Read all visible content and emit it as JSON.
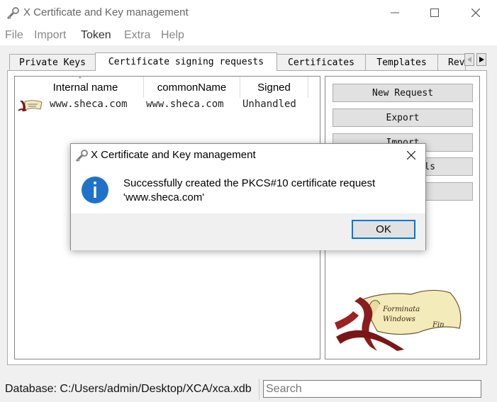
{
  "window": {
    "title": "X Certificate and Key management"
  },
  "menu": [
    "File",
    "Import",
    "Token",
    "Extra",
    "Help"
  ],
  "tabs": [
    "Private Keys",
    "Certificate signing requests",
    "Certificates",
    "Templates",
    "Rev"
  ],
  "list": {
    "columns": [
      "Internal name",
      "commonName",
      "Signed"
    ],
    "rows": [
      {
        "internal_name": "www.sheca.com",
        "common_name": "www.sheca.com",
        "signed": "Unhandled"
      }
    ]
  },
  "buttons": [
    "New Request",
    "Export",
    "Import",
    "ls",
    ""
  ],
  "status": {
    "database": "Database: C:/Users/admin/Desktop/XCA/xca.xdb",
    "search_placeholder": "Search"
  },
  "dialog": {
    "title": "X Certificate and Key management",
    "message_line1": "Successfully created the PKCS#10 certificate request",
    "message_line2": "'www.sheca.com'",
    "ok": "OK"
  },
  "colors": {
    "accent": "#0078d7",
    "info_icon": "#1e73c8"
  }
}
